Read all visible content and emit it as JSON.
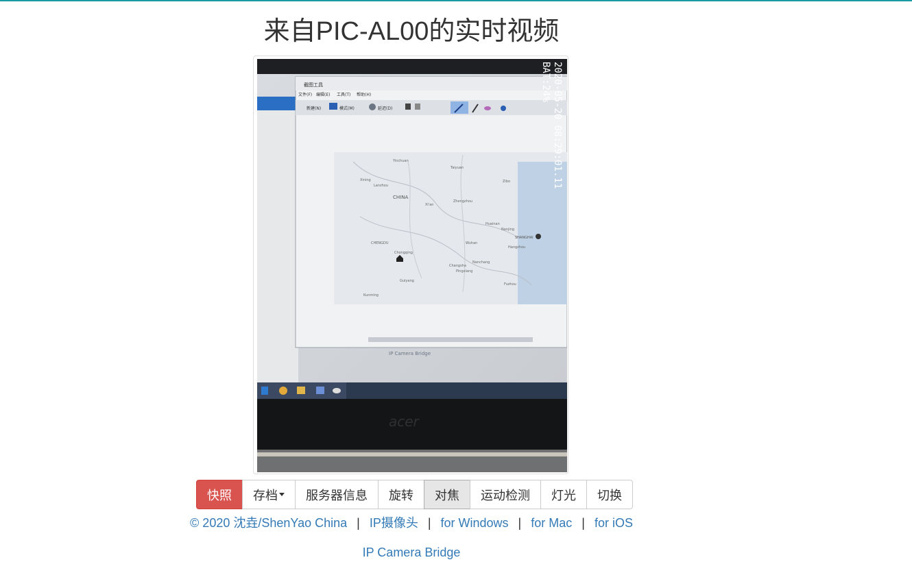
{
  "page": {
    "title": "来自PIC-AL00的实时视频"
  },
  "video": {
    "overlay_datetime": "2020-05-20 08:29:01.11",
    "overlay_battery": "BAT:24%",
    "screen_app_title": "截图工具",
    "screen_menu": [
      "文件(F)",
      "编辑(E)",
      "工具(T)",
      "帮助(H)"
    ],
    "screen_toolbar": [
      "新建(N)",
      "模式(M)",
      "延迟(D)"
    ],
    "map_labels": [
      "Yinchuan",
      "Taiyuan",
      "Xining",
      "Lanzhou",
      "Zibo",
      "CHINA",
      "Xi'an",
      "Zhengzhou",
      "Huainan",
      "Nanjing",
      "SHANGHAI",
      "CHENGDU",
      "Chongqing",
      "Wuhan",
      "Hangzhou",
      "Changsha",
      "Nanchang",
      "Pingxiang",
      "Guiyang",
      "Kunming",
      "Fuzhou"
    ],
    "screen_footer": "IP Camera Bridge",
    "laptop_brand": "acer"
  },
  "toolbar": {
    "buttons": [
      "快照",
      "存档",
      "服务器信息",
      "旋转",
      "对焦",
      "运动检测",
      "灯光",
      "切换"
    ]
  },
  "footer": {
    "copyright": "© 2020 沈垚/ShenYao China",
    "sep": "|",
    "link_ipcam": "IP摄像头",
    "link_windows": "for Windows",
    "link_mac": "for Mac",
    "link_ios": "for iOS",
    "bridge": "IP Camera Bridge"
  },
  "colors": {
    "accent_line": "#1a9aa0",
    "danger": "#d9534f",
    "link": "#337ab7"
  }
}
